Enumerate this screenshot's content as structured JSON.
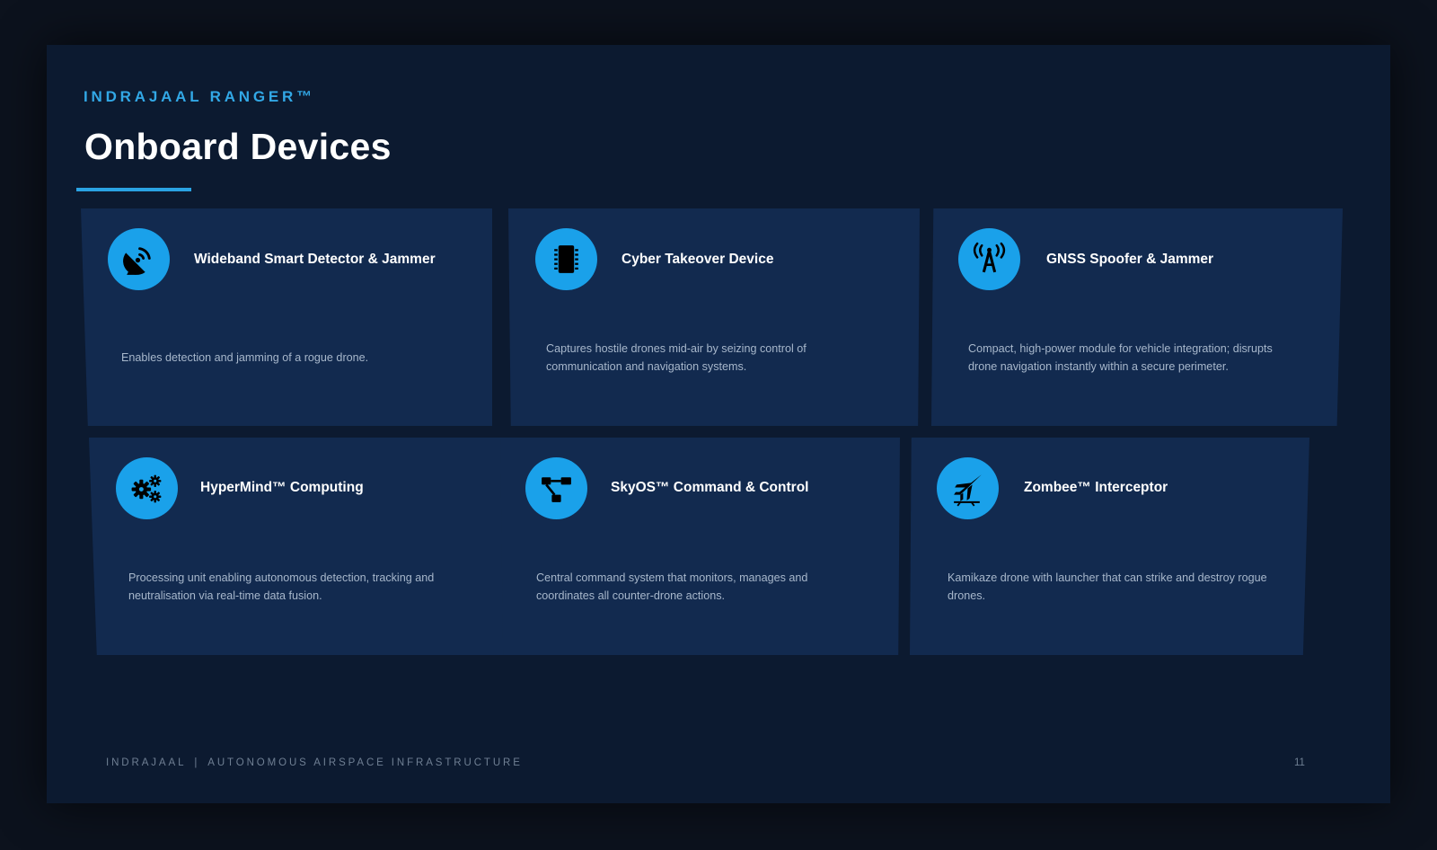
{
  "header": {
    "eyebrow": "INDRAJAAL RANGER™",
    "title": "Onboard Devices"
  },
  "cards": [
    {
      "title": "Wideband Smart Detector & Jammer",
      "description": "Enables detection and jamming of a rogue drone.",
      "icon": "satellite-dish-icon"
    },
    {
      "title": "Cyber Takeover Device",
      "description": "Captures hostile drones mid-air by seizing control of communication and navigation systems.",
      "icon": "microchip-icon"
    },
    {
      "title": "GNSS Spoofer & Jammer",
      "description": "Compact, high-power module for vehicle integration; disrupts drone navigation instantly within a secure perimeter.",
      "icon": "broadcast-tower-icon"
    },
    {
      "title": "HyperMind™ Computing",
      "description": "Processing unit enabling autonomous detection, tracking and neutralisation via real-time data fusion.",
      "icon": "gears-icon"
    },
    {
      "title": "SkyOS™ Command & Control",
      "description": "Central command system that monitors, manages and coordinates all counter-drone actions.",
      "icon": "network-diagram-icon"
    },
    {
      "title": "Zombee™ Interceptor",
      "description": "Kamikaze drone with launcher that can strike and destroy rogue drones.",
      "icon": "jet-interceptor-icon"
    }
  ],
  "footer": {
    "brand": "INDRAJAAL",
    "separator": "|",
    "tagline": "AUTONOMOUS AIRSPACE INFRASTRUCTURE",
    "page_number": "11"
  },
  "colors": {
    "page_background": "#0c121d",
    "slide_background": "#0c1a30",
    "card_background": "#122a4f",
    "accent": "#1aa1ea",
    "eyebrow": "#32a8e6",
    "title_text": "#ffffff",
    "body_text": "#a7b7cb",
    "footer_text": "#6f7f93"
  }
}
